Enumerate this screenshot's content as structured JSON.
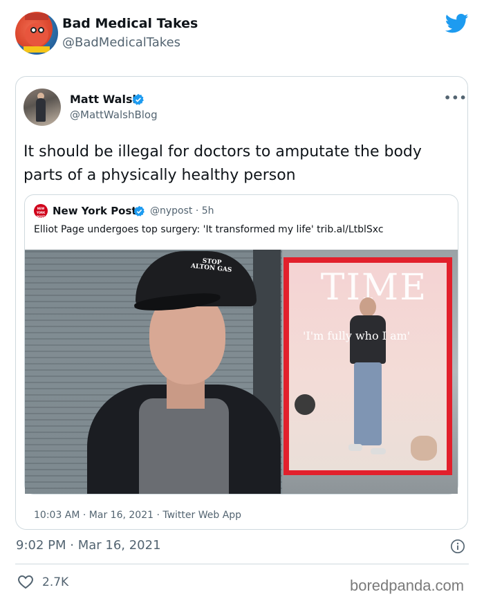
{
  "tweet": {
    "author_name": "Bad Medical Takes",
    "author_handle": "@BadMedicalTakes",
    "timestamp": "9:02 PM · Mar 16, 2021",
    "likes": "2.7K",
    "brand_color": "#1d9bf0"
  },
  "quoted": {
    "author_name": "Matt Walsh",
    "author_handle": "@MattWalshBlog",
    "text": "It should be illegal for doctors to amputate the body parts of a physically healthy person",
    "timestamp": "10:03 AM · Mar 16, 2021 · Twitter Web App"
  },
  "nested": {
    "author_name": "New York Post",
    "handle_time": "@nypost · 5h",
    "text": "Elliot Page undergoes top surgery: 'It transformed my life' trib.al/LtblSxc",
    "media": {
      "cap_text": "STOP ALTON GAS",
      "cover_title": "TIME",
      "cover_headline": "'I'm fully who I am'"
    }
  },
  "watermark": "boredpanda.com",
  "icons": [
    "twitter-bird-icon",
    "verified-icon",
    "more-icon",
    "info-icon",
    "heart-icon"
  ]
}
